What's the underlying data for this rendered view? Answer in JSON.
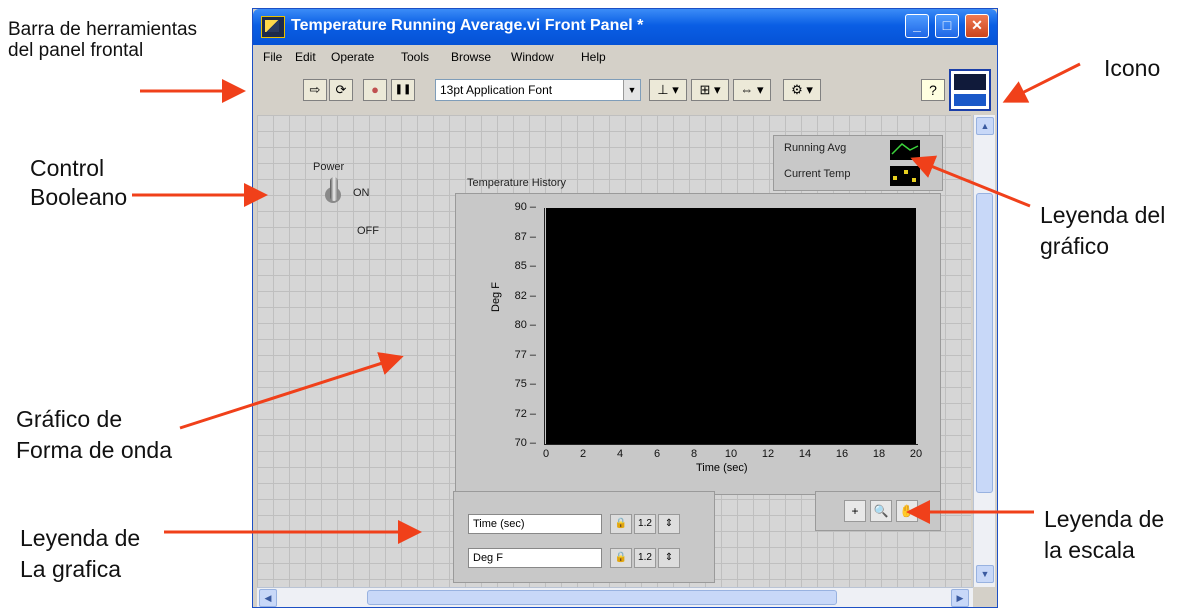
{
  "annotations": {
    "toolbar": "Barra de herramientas\ndel panel frontal",
    "boolean": "Control\nBooleano",
    "waveform": "Gráfico de\nForma de onda",
    "plot_legend": "Leyenda de\nLa grafica",
    "icon": "Icono",
    "chart_legend": "Leyenda del\ngráfico",
    "scale_legend": "Leyenda de\nla escala"
  },
  "window": {
    "title": "Temperature Running Average.vi Front Panel *",
    "buttons": {
      "minimize": "_",
      "maximize": "□",
      "close": "✕"
    }
  },
  "menu": [
    "File",
    "Edit",
    "Operate",
    "Tools",
    "Browse",
    "Window",
    "Help"
  ],
  "toolbar": {
    "run_glyph": "⇨",
    "run_cont_glyph": "⟳",
    "abort_glyph": "●",
    "pause_glyph": "❚❚",
    "font": "13pt Application Font",
    "align_glyph": "⊥",
    "distribute_glyph": "⊞",
    "resize_glyph": "⇔",
    "reorder_glyph": "⚙",
    "help_glyph": "?"
  },
  "panel": {
    "power_label": "Power",
    "on_label": "ON",
    "off_label": "OFF",
    "graph_title": "Temperature History",
    "legend_avg": "Running Avg",
    "legend_temp": "Current Temp",
    "yaxis_label": "Deg F",
    "xaxis_label": "Time (sec)",
    "scale_time": "Time (sec)",
    "scale_deg": "Deg F",
    "scale_lock": "🔒",
    "scale_fmt1": "1.2",
    "scale_fmt2": "⇕",
    "pal_cursor": "+",
    "pal_zoom": "🔍",
    "pal_pan": "✋"
  },
  "chart_data": {
    "type": "line",
    "title": "Temperature History",
    "xlabel": "Time (sec)",
    "ylabel": "Deg F",
    "xlim": [
      0,
      20
    ],
    "ylim": [
      70,
      90
    ],
    "xticks": [
      "0",
      "2",
      "4",
      "6",
      "8",
      "10",
      "12",
      "14",
      "16",
      "18",
      "20"
    ],
    "yticks": [
      "70",
      "72",
      "75",
      "77",
      "80",
      "82",
      "85",
      "87",
      "90"
    ],
    "series": [
      {
        "name": "Running Avg",
        "values": []
      },
      {
        "name": "Current Temp",
        "values": []
      }
    ],
    "grid": false,
    "legend": "top-right"
  }
}
